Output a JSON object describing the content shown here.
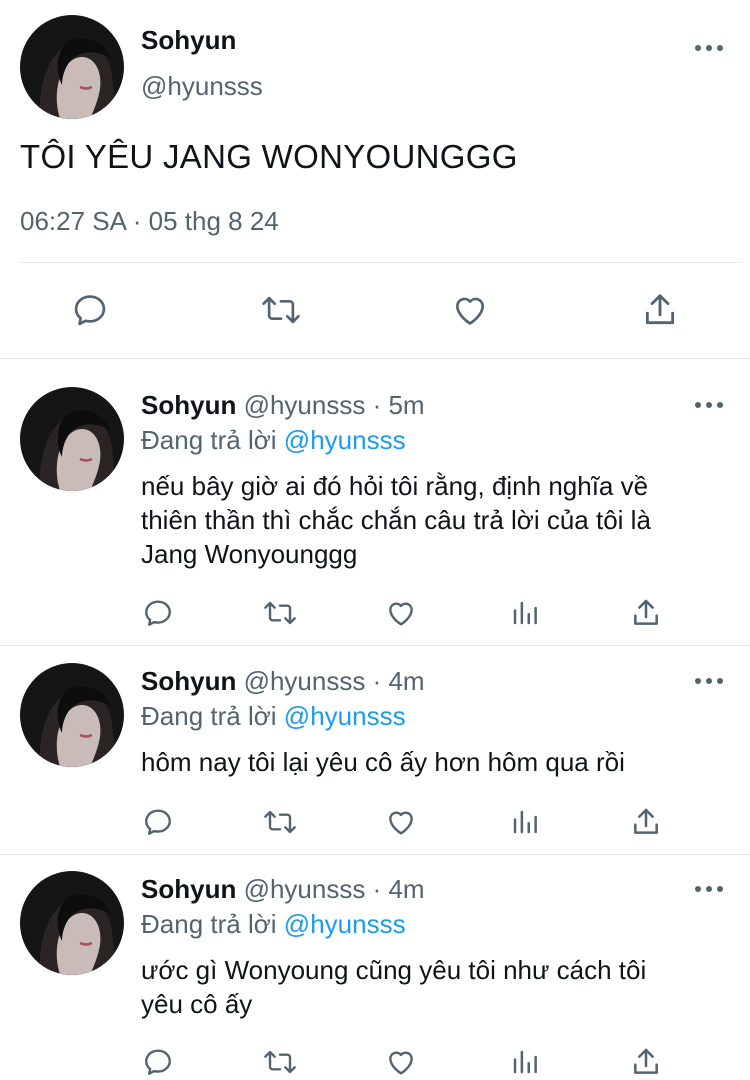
{
  "main_tweet": {
    "name": "Sohyun",
    "handle": "@hyunsss",
    "text": "TÔI YÊU JANG WONYOUNGGG",
    "timestamp": "06:27 SA · 05 thg 8 24",
    "actions": [
      "reply-icon",
      "retweet-icon",
      "like-icon",
      "share-icon"
    ]
  },
  "replies": [
    {
      "name": "Sohyun",
      "handle": "@hyunsss",
      "sep": " · ",
      "time": "5m",
      "replying_label": "Đang trả lời",
      "replying_to": "@hyunsss",
      "text_lines": [
        "nếu bây giờ ai đó hỏi tôi rằng, định nghĩa về",
        "thiên thần thì chắc chắn câu trả lời của tôi là",
        "Jang Wonyounggg"
      ],
      "actions": [
        "reply-icon",
        "retweet-icon",
        "like-icon",
        "views-icon",
        "share-icon"
      ]
    },
    {
      "name": "Sohyun",
      "handle": "@hyunsss",
      "sep": " · ",
      "time": "4m",
      "replying_label": "Đang trả lời",
      "replying_to": "@hyunsss",
      "text_lines": [
        "hôm nay tôi lại yêu cô ấy hơn hôm qua rồi"
      ],
      "actions": [
        "reply-icon",
        "retweet-icon",
        "like-icon",
        "views-icon",
        "share-icon"
      ]
    },
    {
      "name": "Sohyun",
      "handle": "@hyunsss",
      "sep": " · ",
      "time": "4m",
      "replying_label": "Đang trả lời",
      "replying_to": "@hyunsss",
      "text_lines": [
        "ước gì Wonyoung cũng yêu tôi như cách tôi",
        "yêu cô ấy"
      ],
      "actions": [
        "reply-icon",
        "retweet-icon",
        "like-icon",
        "views-icon",
        "share-icon"
      ]
    }
  ],
  "colors": {
    "text": "#0f1419",
    "secondary": "#536471",
    "link": "#1d9bf0",
    "divider": "#e6e9eb"
  }
}
